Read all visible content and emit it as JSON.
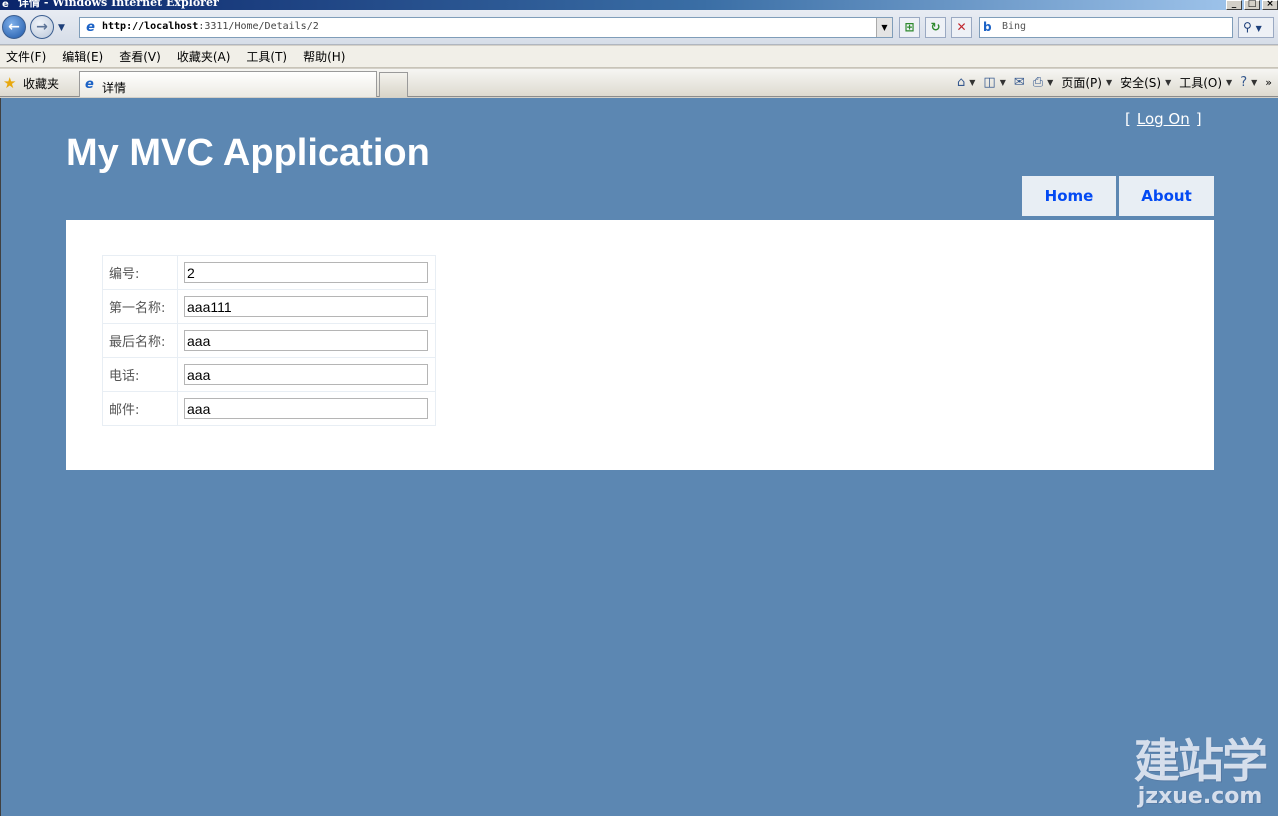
{
  "window": {
    "title": "详情 - Windows Internet Explorer"
  },
  "addressbar": {
    "url_host": "http://localhost",
    "url_path": ":3311/Home/Details/2",
    "search_placeholder": "Bing"
  },
  "menubar": {
    "items": [
      "文件(F)",
      "编辑(E)",
      "查看(V)",
      "收藏夹(A)",
      "工具(T)",
      "帮助(H)"
    ]
  },
  "favbar": {
    "favorites_label": "收藏夹",
    "tab_label": "详情",
    "commands": [
      "页面(P)",
      "安全(S)",
      "工具(O)"
    ]
  },
  "page": {
    "login_link": "Log On",
    "site_title": "My MVC Application",
    "nav": [
      "Home",
      "About"
    ],
    "fields": [
      {
        "label": "编号:",
        "value": "2"
      },
      {
        "label": "第一名称:",
        "value": "aaa111"
      },
      {
        "label": "最后名称:",
        "value": "aaa"
      },
      {
        "label": "电话:",
        "value": "aaa"
      },
      {
        "label": "邮件:",
        "value": "aaa"
      }
    ]
  },
  "watermark": {
    "cn": "建站学",
    "en": "jzxue.com"
  },
  "colors": {
    "page_bg": "#5c87b2",
    "nav_tab_bg": "#e8eef4",
    "nav_tab_text": "#034af3"
  }
}
